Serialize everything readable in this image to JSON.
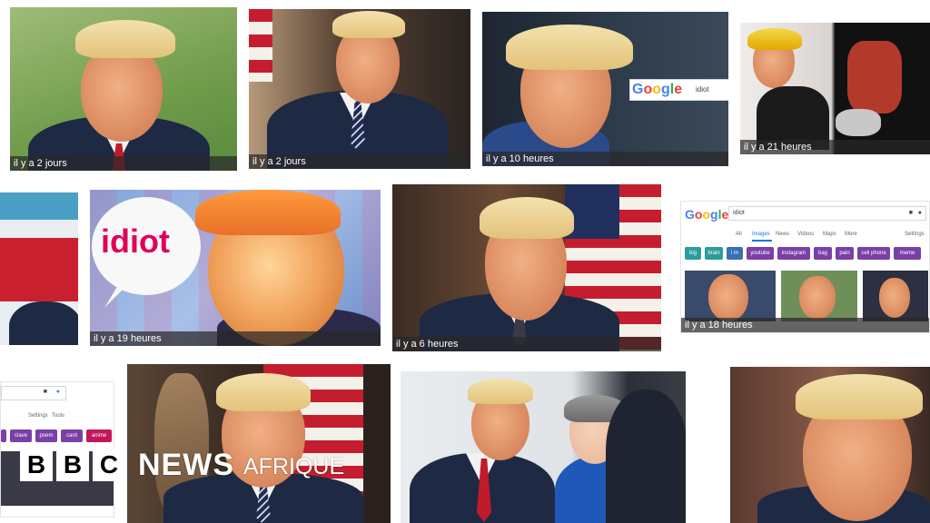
{
  "results": [
    {
      "time": "il y a 2 jours"
    },
    {
      "time": "il y a 2 jours"
    },
    {
      "time": "il y a 10 heures"
    },
    {
      "time": "il y a 21 heures"
    },
    {
      "time": "il y a 19 heures"
    },
    {
      "time": "il y a 6 heures"
    },
    {
      "time": "il y a 18 heures"
    }
  ],
  "speech_bubble": {
    "text": "idiot"
  },
  "google": {
    "logo_letters": [
      "G",
      "o",
      "o",
      "g",
      "l",
      "e"
    ],
    "query": "idiot",
    "nav": [
      "All",
      "Images",
      "News",
      "Videos",
      "Maps",
      "More",
      "Settings"
    ],
    "chips": [
      "big",
      "brain",
      "i m",
      "youtube",
      "instagram",
      "bag",
      "pain",
      "cell phone",
      "meme"
    ],
    "chips_small": [
      "clave",
      "poem",
      "card",
      "anime"
    ],
    "tools_small": [
      "Settings",
      "Tools"
    ]
  },
  "brand": {
    "letters": [
      "B",
      "B",
      "C"
    ],
    "news": "NEWS",
    "region": "AFRIQUE"
  },
  "colors": {
    "caption_bg": "#282828",
    "chip_purple": "#7b3fa8",
    "chip_teal": "#2a9d9a",
    "chip_pink": "#c2185b"
  }
}
